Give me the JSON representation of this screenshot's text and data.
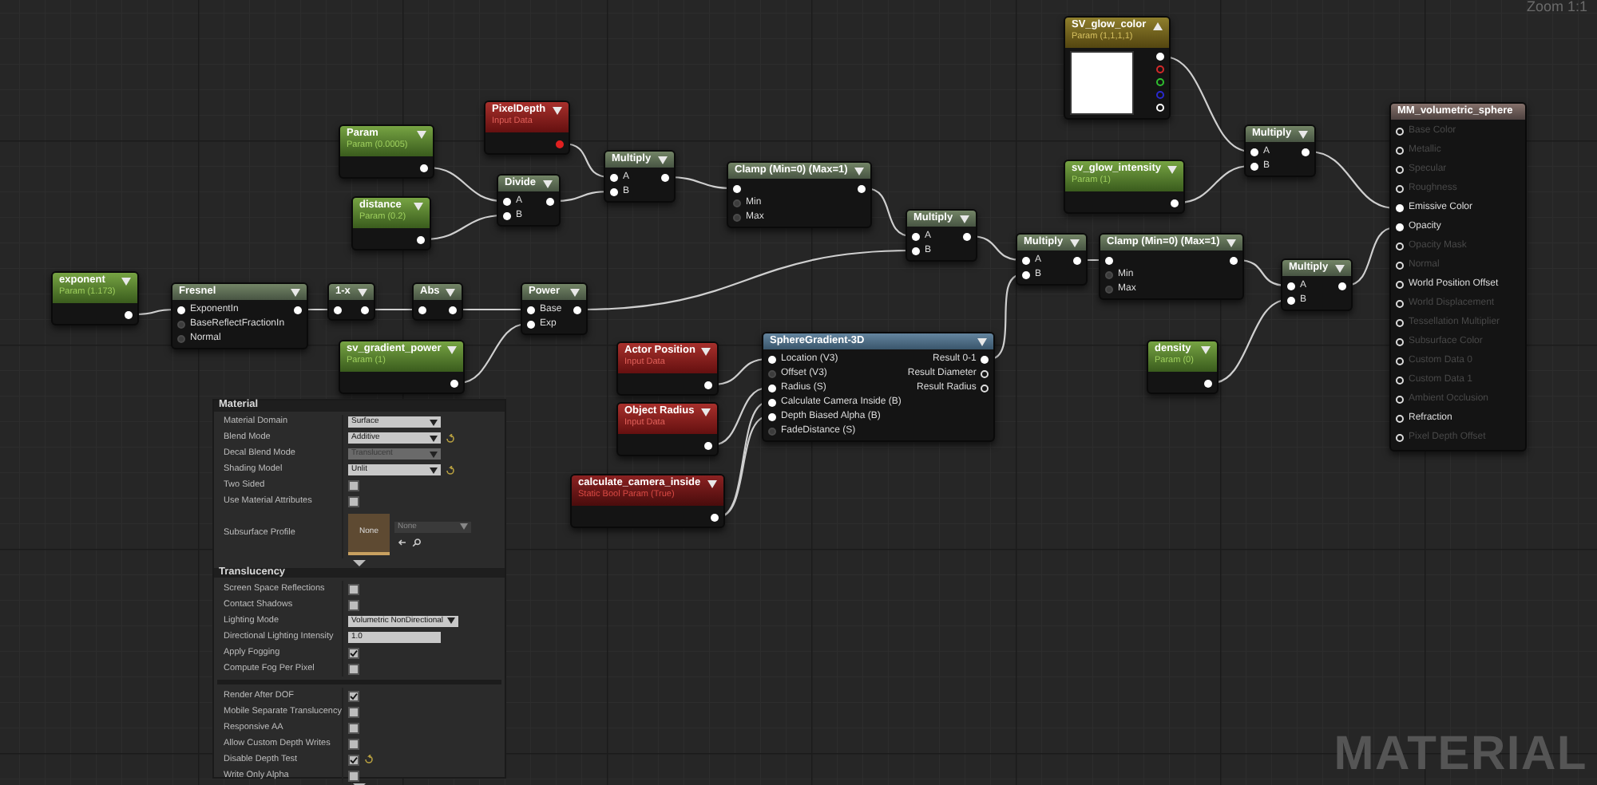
{
  "zoom_label": "Zoom 1:1",
  "graph_label": "MATERIAL",
  "nodes": [
    {
      "kind": "param",
      "title": "exponent",
      "subtitle": "Param (1.173)",
      "outputs": [
        {
          "connected": true
        }
      ]
    },
    {
      "kind": "math",
      "title": "Fresnel",
      "inputs": [
        {
          "label": "ExponentIn",
          "connected": true
        },
        {
          "label": "BaseReflectFractionIn",
          "connected": false
        },
        {
          "label": "Normal",
          "connected": false
        }
      ],
      "outputs": [
        {
          "connected": true
        }
      ]
    },
    {
      "kind": "param",
      "title": "Param",
      "subtitle": "Param (0.0005)",
      "outputs": [
        {
          "connected": true
        }
      ]
    },
    {
      "kind": "param",
      "title": "distance",
      "subtitle": "Param (0.2)",
      "outputs": [
        {
          "connected": true
        }
      ]
    },
    {
      "kind": "math",
      "title": "1-x",
      "inputs": [
        {
          "connected": true
        }
      ],
      "outputs": [
        {
          "connected": true
        }
      ]
    },
    {
      "kind": "math",
      "title": "Abs",
      "inputs": [
        {
          "connected": true
        }
      ],
      "outputs": [
        {
          "connected": true
        }
      ]
    },
    {
      "kind": "param",
      "title": "sv_gradient_power",
      "subtitle": "Param (1)",
      "outputs": [
        {
          "connected": true
        }
      ]
    },
    {
      "kind": "input",
      "title": "PixelDepth",
      "subtitle": "Input Data",
      "outputs": [
        {
          "connected": true,
          "color": "#e02020"
        }
      ]
    },
    {
      "kind": "math",
      "title": "Divide",
      "inputs": [
        {
          "label": "A",
          "connected": true
        },
        {
          "label": "B",
          "connected": true
        }
      ],
      "outputs": [
        {
          "connected": true
        }
      ]
    },
    {
      "kind": "math",
      "title": "Power",
      "inputs": [
        {
          "label": "Base",
          "connected": true
        },
        {
          "label": "Exp",
          "connected": true
        }
      ],
      "outputs": [
        {
          "connected": true
        }
      ]
    },
    {
      "kind": "math",
      "title": "Multiply",
      "inputs": [
        {
          "label": "A",
          "connected": true
        },
        {
          "label": "B",
          "connected": true
        }
      ],
      "outputs": [
        {
          "connected": true
        }
      ]
    },
    {
      "kind": "input",
      "title": "Actor Position",
      "subtitle": "Input Data",
      "outputs": [
        {
          "connected": true
        }
      ]
    },
    {
      "kind": "input",
      "title": "Object Radius",
      "subtitle": "Input Data",
      "outputs": [
        {
          "connected": true
        }
      ]
    },
    {
      "kind": "bool_param",
      "title": "calculate_camera_inside",
      "subtitle": "Static Bool Param (True)",
      "outputs": [
        {
          "connected": true
        }
      ]
    },
    {
      "kind": "math",
      "title": "Clamp (Min=0) (Max=1)",
      "inputs": [
        {
          "connected": true
        },
        {
          "label": "Min",
          "connected": false
        },
        {
          "label": "Max",
          "connected": false
        }
      ],
      "outputs": [
        {
          "connected": true
        }
      ]
    },
    {
      "kind": "math",
      "title": "Multiply",
      "inputs": [
        {
          "label": "A",
          "connected": true
        },
        {
          "label": "B",
          "connected": true
        }
      ],
      "outputs": [
        {
          "connected": true
        }
      ]
    },
    {
      "kind": "function",
      "title": "SphereGradient-3D",
      "inputs": [
        {
          "label": "Location (V3)",
          "connected": true
        },
        {
          "label": "Offset (V3)",
          "connected": false
        },
        {
          "label": "Radius (S)",
          "connected": true
        },
        {
          "label": "Calculate Camera Inside (B)",
          "connected": true
        },
        {
          "label": "Depth Biased Alpha (B)",
          "connected": true
        },
        {
          "label": "FadeDistance (S)",
          "connected": false
        }
      ],
      "outputs": [
        {
          "label": "Result 0-1",
          "connected": true
        },
        {
          "label": "Result Diameter",
          "connected": false
        },
        {
          "label": "Result Radius",
          "connected": false
        }
      ]
    },
    {
      "kind": "math",
      "title": "Multiply",
      "inputs": [
        {
          "label": "A",
          "connected": true
        },
        {
          "label": "B",
          "connected": true
        }
      ],
      "outputs": [
        {
          "connected": true
        }
      ]
    },
    {
      "kind": "vector",
      "title": "SV_glow_color",
      "subtitle": "Param (1,1,1,1)",
      "outputs": [
        {
          "connected": true,
          "color": "#ffffff"
        },
        {
          "connected": false,
          "color": "#d42a2a"
        },
        {
          "connected": false,
          "color": "#2fbf2f"
        },
        {
          "connected": false,
          "color": "#2a2ad0"
        },
        {
          "connected": false,
          "color": "#ffffff"
        }
      ]
    },
    {
      "kind": "param",
      "title": "sv_glow_intensity",
      "subtitle": "Param (1)",
      "outputs": [
        {
          "connected": true
        }
      ]
    },
    {
      "kind": "math",
      "title": "Clamp (Min=0) (Max=1)",
      "inputs": [
        {
          "connected": true
        },
        {
          "label": "Min",
          "connected": false
        },
        {
          "label": "Max",
          "connected": false
        }
      ],
      "outputs": [
        {
          "connected": true
        }
      ]
    },
    {
      "kind": "param",
      "title": "density",
      "subtitle": "Param (0)",
      "outputs": [
        {
          "connected": true
        }
      ]
    },
    {
      "kind": "math",
      "title": "Multiply",
      "inputs": [
        {
          "label": "A",
          "connected": true
        },
        {
          "label": "B",
          "connected": true
        }
      ],
      "outputs": [
        {
          "connected": true
        }
      ]
    },
    {
      "kind": "math",
      "title": "Multiply",
      "inputs": [
        {
          "label": "A",
          "connected": true
        },
        {
          "label": "B",
          "connected": true
        }
      ],
      "outputs": [
        {
          "connected": true
        }
      ]
    },
    {
      "kind": "result",
      "title": "MM_volumetric_sphere",
      "inputs": [
        {
          "label": "Base Color",
          "connected": false,
          "disabled": true
        },
        {
          "label": "Metallic",
          "connected": false,
          "disabled": true
        },
        {
          "label": "Specular",
          "connected": false,
          "disabled": true
        },
        {
          "label": "Roughness",
          "connected": false,
          "disabled": true
        },
        {
          "label": "Emissive Color",
          "connected": true,
          "disabled": false
        },
        {
          "label": "Opacity",
          "connected": true,
          "disabled": false
        },
        {
          "label": "Opacity Mask",
          "connected": false,
          "disabled": true
        },
        {
          "label": "Normal",
          "connected": false,
          "disabled": true
        },
        {
          "label": "World Position Offset",
          "connected": false,
          "disabled": false
        },
        {
          "label": "World Displacement",
          "connected": false,
          "disabled": true
        },
        {
          "label": "Tessellation Multiplier",
          "connected": false,
          "disabled": true
        },
        {
          "label": "Subsurface Color",
          "connected": false,
          "disabled": true
        },
        {
          "label": "Custom Data 0",
          "connected": false,
          "disabled": true
        },
        {
          "label": "Custom Data 1",
          "connected": false,
          "disabled": true
        },
        {
          "label": "Ambient Occlusion",
          "connected": false,
          "disabled": true
        },
        {
          "label": "Refraction",
          "connected": false,
          "disabled": false
        },
        {
          "label": "Pixel Depth Offset",
          "connected": false,
          "disabled": true
        }
      ]
    }
  ],
  "details_panel": {
    "sections": [
      {
        "title": "Material",
        "rows": [
          {
            "kind": "dropdown",
            "label": "Material Domain",
            "value": "Surface",
            "disabled": false,
            "modified": false
          },
          {
            "kind": "dropdown",
            "label": "Blend Mode",
            "value": "Additive",
            "disabled": false,
            "modified": true
          },
          {
            "kind": "dropdown",
            "label": "Decal Blend Mode",
            "value": "Translucent",
            "disabled": true,
            "modified": false
          },
          {
            "kind": "dropdown",
            "label": "Shading Model",
            "value": "Unlit",
            "disabled": false,
            "modified": true
          },
          {
            "kind": "checkbox",
            "label": "Two Sided",
            "checked": false,
            "modified": false
          },
          {
            "kind": "checkbox",
            "label": "Use Material Attributes",
            "checked": false,
            "modified": false
          },
          {
            "kind": "asset",
            "label": "Subsurface Profile",
            "thumbnail": "None",
            "value": "None"
          }
        ]
      },
      {
        "title": "Translucency",
        "rows": [
          {
            "kind": "checkbox",
            "label": "Screen Space Reflections",
            "checked": false,
            "modified": false
          },
          {
            "kind": "checkbox",
            "label": "Contact Shadows",
            "checked": false,
            "modified": false
          },
          {
            "kind": "dropdown",
            "label": "Lighting Mode",
            "value": "Volumetric NonDirectional",
            "disabled": false,
            "modified": false
          },
          {
            "kind": "number",
            "label": "Directional Lighting Intensity",
            "value": "1.0"
          },
          {
            "kind": "checkbox",
            "label": "Apply Fogging",
            "checked": true,
            "modified": false
          },
          {
            "kind": "checkbox",
            "label": "Compute Fog Per Pixel",
            "checked": false,
            "modified": false
          },
          {
            "kind": "separator"
          },
          {
            "kind": "checkbox",
            "label": "Render After DOF",
            "checked": true,
            "modified": false
          },
          {
            "kind": "checkbox",
            "label": "Mobile Separate Translucency",
            "checked": false,
            "modified": false
          },
          {
            "kind": "checkbox",
            "label": "Responsive AA",
            "checked": false,
            "modified": false
          },
          {
            "kind": "checkbox",
            "label": "Allow Custom Depth Writes",
            "checked": false,
            "modified": false
          },
          {
            "kind": "checkbox",
            "label": "Disable Depth Test",
            "checked": true,
            "modified": true
          },
          {
            "kind": "checkbox",
            "label": "Write Only Alpha",
            "checked": false,
            "modified": false
          }
        ]
      }
    ]
  }
}
